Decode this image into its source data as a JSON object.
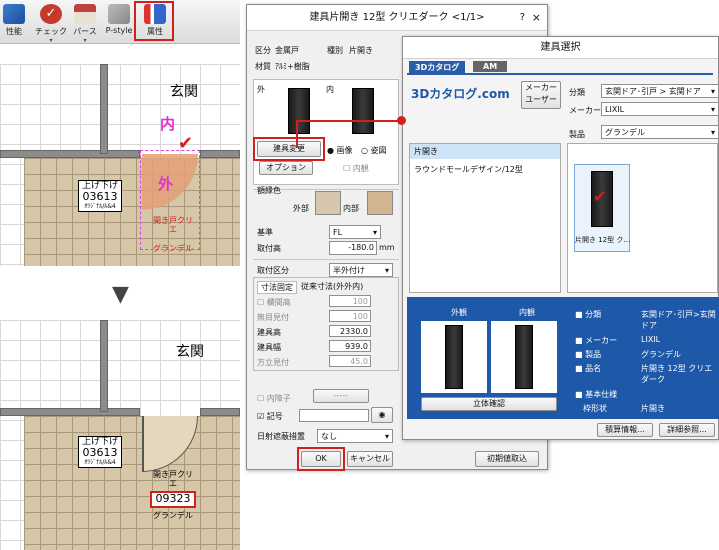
{
  "toolbar": {
    "items": [
      {
        "label": "性能"
      },
      {
        "label": "チェック"
      },
      {
        "label": "パース"
      },
      {
        "label": "P-style"
      },
      {
        "label": "属性"
      }
    ]
  },
  "plan": {
    "room_name": "玄関",
    "inner": "内",
    "outer": "外",
    "fitting_top": "上げ下げ",
    "fitting_code_before": "03613",
    "fitting_sub": "ｵﾘｼﾞﾅﾙ/ﾙ&4",
    "door_label": "開き戸クリエ",
    "door_code_after": "09323",
    "door_series": "グランデル"
  },
  "arrow_glyph": "▼",
  "attr_dialog": {
    "title": "建具片開き 12型 クリエダーク <1/1>",
    "title_controls": [
      "?",
      "×"
    ],
    "kubun_label": "区分",
    "kubun": "金属戸",
    "shubetsu_label": "種別",
    "shubetsu": "片開き",
    "material_label": "材質",
    "material": "ｱﾙﾐ+樹脂",
    "out_label": "外",
    "in_label": "内",
    "change_button": "建具変更",
    "radio_image": "画像",
    "radio_elev": "姿図",
    "option_button": "オプション",
    "naikan": "内観",
    "frame_color_label": "額縁色",
    "outer_label": "外部",
    "inner_label": "内部",
    "base_label": "基準",
    "base_value": "FL",
    "height_label": "取付高",
    "height_value": "-180.0",
    "mm": "mm",
    "torituke_label": "取付区分",
    "torituke_value": "半外付け",
    "tab1": "寸法固定",
    "tab2": "従来寸法(外外内)",
    "dim_rows": [
      {
        "label": "欄間高",
        "value": "100"
      },
      {
        "label": "無目見付",
        "value": "100"
      },
      {
        "label": "建具高",
        "value": "2330.0"
      },
      {
        "label": "建具幅",
        "value": "939.0"
      },
      {
        "label": "方立見付",
        "value": "45.0"
      }
    ],
    "uchishoji": "内障子",
    "uchishoji_val": "-----",
    "kigo": "記号",
    "shading_label": "日射遮蔽措置",
    "shading_value": "なし",
    "ok": "OK",
    "cancel": "キャンセル",
    "reset": "初期値取込"
  },
  "catalog": {
    "title": "建具選択",
    "tab_3d": "3Dカタログ",
    "tab_am": "AM",
    "logo": "3Dカタログ.com",
    "maker_user": "メーカー ユーザー",
    "bunrui_label": "分類",
    "bunrui": "玄関ドア･引戸 > 玄関ドア",
    "maker_label": "メーカー",
    "maker": "LIXIL",
    "seihin_label": "製品",
    "seihin": "グランデル",
    "list": [
      "片開き",
      "ラウンドモールデザイン/12型"
    ],
    "thumb_caption": "片開き 12型 ク…",
    "preview_out": "外観",
    "preview_in": "内観",
    "solid_button": "立体確認",
    "info": [
      {
        "k": "分類",
        "v": "玄関ドア･引戸>玄関ドア"
      },
      {
        "k": "メーカー",
        "v": "LIXIL"
      },
      {
        "k": "製品",
        "v": "グランデル"
      },
      {
        "k": "品名",
        "v": "片開き 12型 クリエダーク"
      },
      {
        "k": "基本仕様",
        "v": ""
      },
      {
        "k": "枠形状",
        "v": "片開き"
      }
    ],
    "estimate_button": "積算情報...",
    "detail_button": "詳細参照..."
  },
  "colors": {
    "accent": "#d41f1f",
    "catalog_blue": "#1e58a8",
    "tab_blue": "#2a5ea8"
  }
}
